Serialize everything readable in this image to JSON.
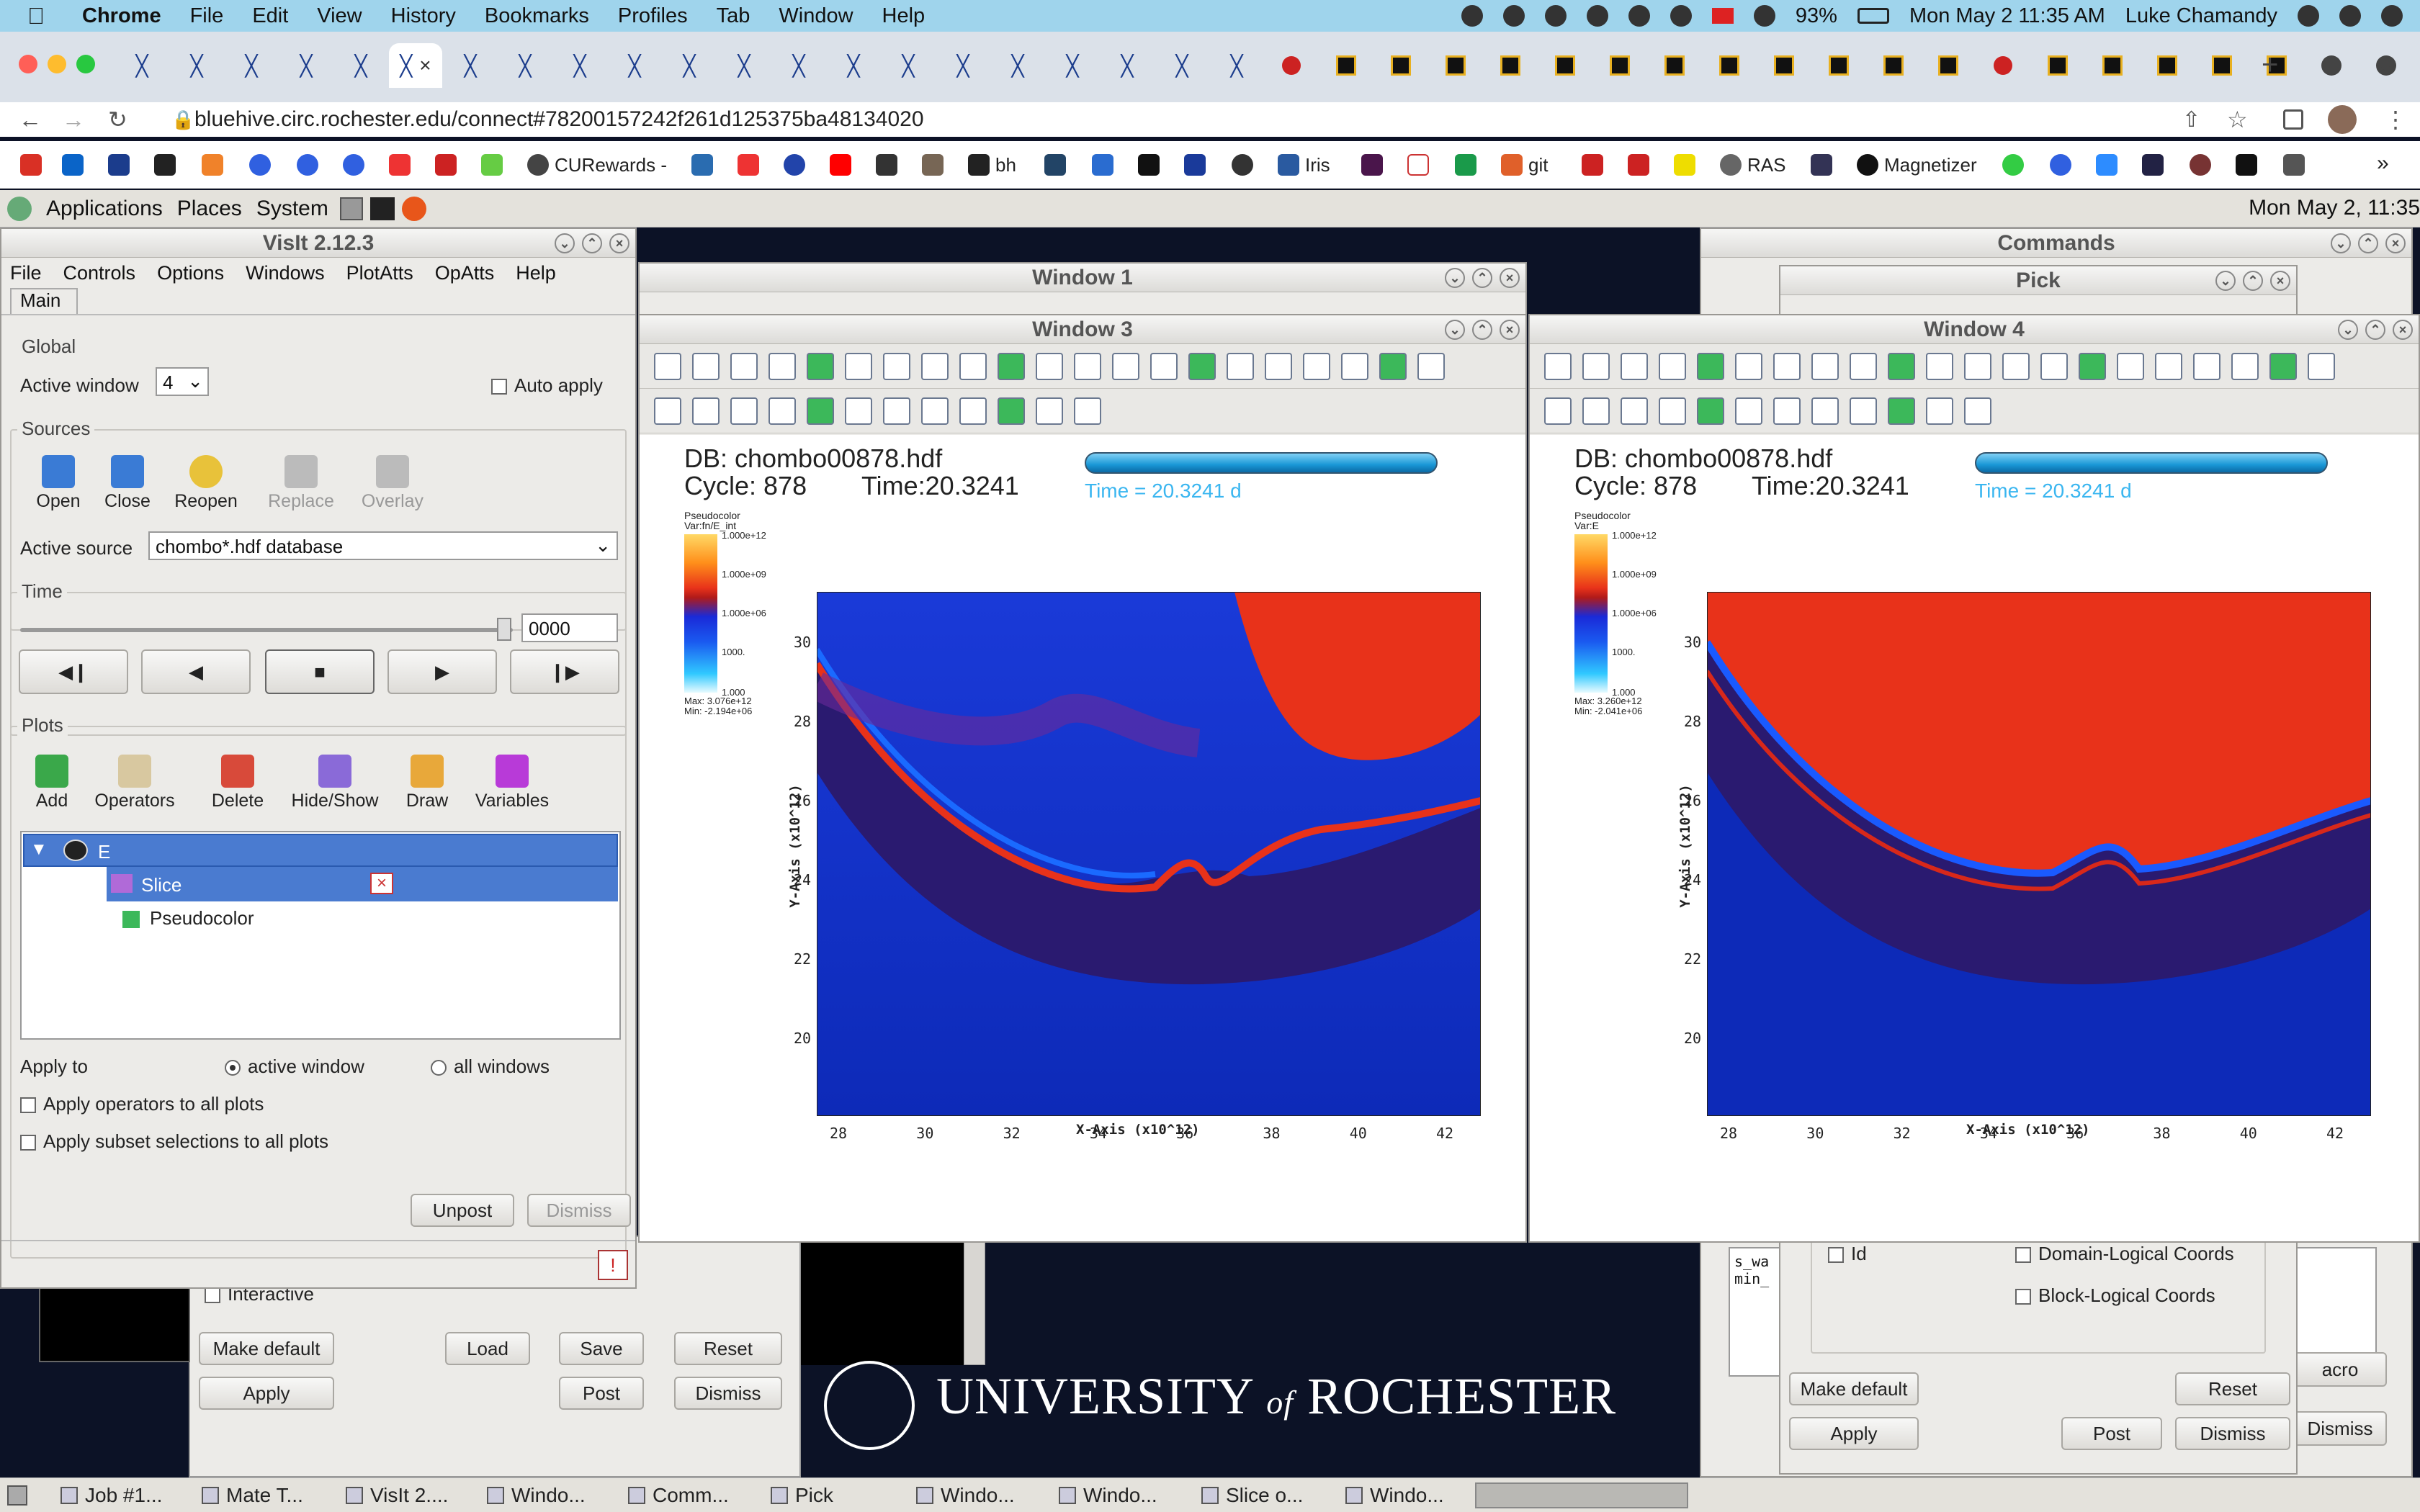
{
  "mac_menubar": {
    "app_name": "Chrome",
    "menus": [
      "File",
      "Edit",
      "View",
      "History",
      "Bookmarks",
      "Profiles",
      "Tab",
      "Window",
      "Help"
    ],
    "battery": "93%",
    "datetime": "Mon May 2  11:35 AM",
    "user": "Luke Chamandy"
  },
  "browser": {
    "url": "bluehive.circ.rochester.edu/connect#78200157242f261d125375ba48134020",
    "bookmarks": [
      "CURewards -",
      "bh",
      "Iris",
      "git",
      "RAS",
      "Magnetizer"
    ]
  },
  "gnome_panel": {
    "menus": [
      "Applications",
      "Places",
      "System"
    ],
    "clock": "Mon May  2, 11:35"
  },
  "visit_main": {
    "title": "VisIt 2.12.3",
    "menus": [
      "File",
      "Controls",
      "Options",
      "Windows",
      "PlotAtts",
      "OpAtts",
      "Help"
    ],
    "tab": "Main",
    "global_label": "Global",
    "active_window_label": "Active window",
    "active_window_value": "4",
    "auto_apply": "Auto apply",
    "sources_label": "Sources",
    "source_tools": [
      "Open",
      "Close",
      "Reopen",
      "Replace",
      "Overlay"
    ],
    "active_source_label": "Active source",
    "active_source_value": "chombo*.hdf database",
    "time_label": "Time",
    "time_value": "0000",
    "plots_label": "Plots",
    "plot_tools": [
      "Add",
      "Operators",
      "Delete",
      "Hide/Show",
      "Draw",
      "Variables"
    ],
    "plot_tree": {
      "root": "E",
      "operator": "Slice",
      "plot": "Pseudocolor"
    },
    "apply_to_label": "Apply to",
    "apply_active": "active window",
    "apply_all": "all windows",
    "apply_ops": "Apply operators to all plots",
    "apply_subset": "Apply subset selections to all plots",
    "unpost": "Unpost",
    "dismiss": "Dismiss"
  },
  "background_panels": {
    "interactive": "Interactive",
    "make_default": "Make default",
    "load": "Load",
    "save": "Save",
    "reset": "Reset",
    "apply": "Apply",
    "post": "Post",
    "dismiss": "Dismiss",
    "university_pre": "UNIVERSITY",
    "university_of": "of",
    "university_post": "ROCHESTER"
  },
  "window1": {
    "title": "Window 1"
  },
  "window3": {
    "title": "Window 3",
    "db": "DB: chombo00878.hdf",
    "cycle": "Cycle: 878",
    "time": "Time:20.3241",
    "time_annot": "Time = 20.3241 d",
    "legend_head1": "Pseudocolor",
    "legend_head2": "Var:fn/E_int",
    "legend_ticks": [
      "1.000e+12",
      "1.000e+09",
      "1.000e+06",
      "1000.",
      "1.000"
    ],
    "legend_max": "Max: 3.076e+12",
    "legend_min": "Min: -2.194e+06",
    "xlabel": "X-Axis (x10^12)",
    "ylabel": "Y-Axis (x10^12)",
    "xticks": [
      "28",
      "30",
      "32",
      "34",
      "36",
      "38",
      "40",
      "42"
    ],
    "yticks": [
      "30",
      "28",
      "26",
      "24",
      "22",
      "20"
    ]
  },
  "window4": {
    "title": "Window 4",
    "db": "DB: chombo00878.hdf",
    "cycle": "Cycle: 878",
    "time": "Time:20.3241",
    "time_annot": "Time = 20.3241 d",
    "legend_head1": "Pseudocolor",
    "legend_head2": "Var:E",
    "legend_ticks": [
      "1.000e+12",
      "1.000e+09",
      "1.000e+06",
      "1000.",
      "1.000"
    ],
    "legend_max": "Max: 3.260e+12",
    "legend_min": "Min: -2.041e+06",
    "xlabel": "X-Axis (x10^12)",
    "ylabel": "Y-Axis (x10^12)",
    "xticks": [
      "28",
      "30",
      "32",
      "34",
      "36",
      "38",
      "40",
      "42"
    ],
    "yticks": [
      "30",
      "28",
      "26",
      "24",
      "22",
      "20"
    ]
  },
  "commands_window": {
    "title": "Commands",
    "snippet1": "s_wa",
    "snippet2": "min_",
    "macro": "acro"
  },
  "pick_window": {
    "title": "Pick",
    "id": "Id",
    "domain_logical": "Domain-Logical Coords",
    "block_logical": "Block-Logical Coords",
    "make_default": "Make default",
    "reset": "Reset",
    "apply": "Apply",
    "post": "Post",
    "dismiss": "Dismiss"
  },
  "taskbar": [
    "Job #1...",
    "Mate T...",
    "VisIt 2....",
    "Windo...",
    "Comm...",
    "Pick",
    "Windo...",
    "Windo...",
    "Slice o...",
    "Windo..."
  ],
  "colors": {
    "accent_selection": "#4a7bd0",
    "plot_red": "#e8321a",
    "plot_blue": "#1a3ad8",
    "plot_purple": "#3a1a6a"
  }
}
